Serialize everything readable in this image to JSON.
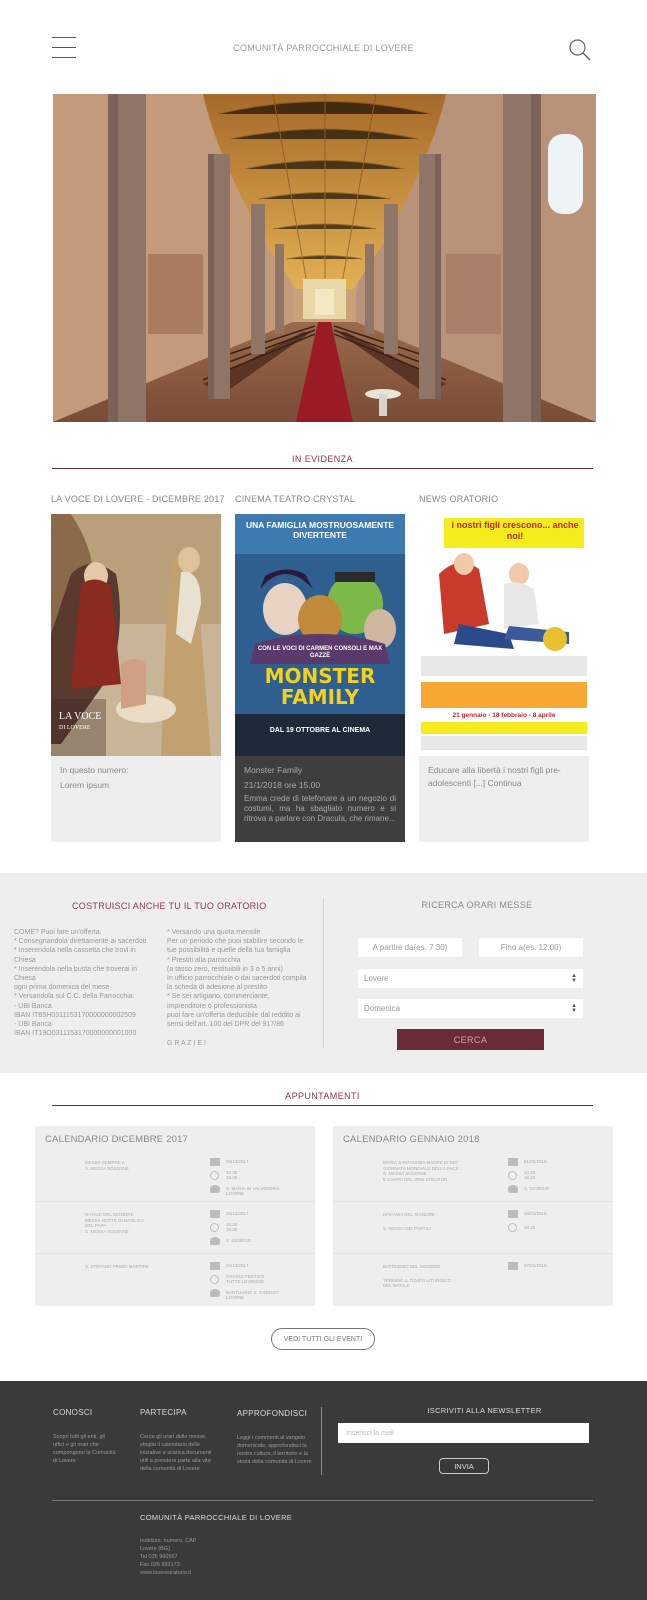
{
  "header": {
    "title": "COMUNITÀ PARROCCHIALE DI LOVERE",
    "menu_icon": "hamburger-menu-icon",
    "search_icon": "search-icon"
  },
  "evidenza": {
    "title": "IN EVIDENZA",
    "cards": [
      {
        "label": "LA VOCE DI LOVERE - DICEMBRE 2017",
        "text1": "In questo numero:",
        "text2": "Lorem ipsum"
      },
      {
        "label": "CINEMA TEATRO CRYSTAL",
        "poster_top": "UNA FAMIGLIA MOSTRUOSAMENTE DIVERTENTE",
        "poster_mid": "CON LE VOCI DI CARMEN CONSOLI E MAX GAZZÈ",
        "poster_title1": "MONSTER",
        "poster_title2": "FAMILY",
        "poster_bottom": "DAL 19 OTTOBRE AL CINEMA",
        "text1": "Monster Family",
        "text2": "21/1/2018 ore 15.00",
        "text3": "Emma crede di telefonare a un negozio di costumi, ma ha sbagliato numero e si ritrova a parlare con Dracula, che rimane..."
      },
      {
        "label": "NEWS ORATORIO",
        "flyer_title": "i nostri figli crescono... anche noi!",
        "flyer_dates": "21 gennaio - 18 febbraio - 8 aprile",
        "text1": "Educare alla libertà i nostri figli pre-adolescenti [...] Continua"
      }
    ]
  },
  "oratorio": {
    "title": "COSTRUISCI ANCHE TU IL TUO ORATORIO",
    "col1": [
      "COME? Puoi fare un'offerta:",
      "* Consegnandola direttamente ai sacerdoti",
      "* Inserendola nella cassetta che trovi in Chiesa",
      "* Inserendola nella busta che troverai in Chiesa",
      "ogni prima domenica del mese",
      "* Versandola sul C.C. della Parrocchia:",
      "- UBI Banca",
      "IBAN IT65H0311153170000000002509",
      "- UBI Banca",
      "IBAN IT19O0311153170000000001000"
    ],
    "col2": [
      "* Versando una quota mensile",
      "Per un periodo che puoi stabilire secondo le tue possibilità e quelle della tua famiglia",
      "* Prestiti alla parrocchia",
      "(a tasso zero, restituibili in 3 o 5 anni)",
      "In ufficio parrocchiale o dai sacerdoti compila la scheda di adesione al prestito",
      "* Se sei artigiano, commerciante, imprenditore o professionista",
      "puoi fare un'offerta deducibile dal reddito ai sensi dell'art. 100 del DPR del 917/86"
    ],
    "thanks": "G R A Z I E !"
  },
  "messe": {
    "title": "RICERCA ORARI MESSE",
    "from_placeholder": "A partire da(es. 7.30)",
    "to_placeholder": "Fino a(es. 12.00)",
    "place": "Lovere",
    "day": "Domenica",
    "search_label": "CERCA"
  },
  "appuntamenti": {
    "title": "APPUNTAMENTI",
    "calendars": [
      {
        "title": "CALENDARIO DICEMBRE 2017",
        "events": [
          {
            "left": [
              "MESSA SEMPRE A",
              "S. MESSA SOLENNE"
            ],
            "right": [
              "08/12/2017",
              "10.30",
              "18.30",
              "S. MARIA IN VALVENDRA",
              "LOVERE"
            ]
          },
          {
            "left": [
              "NATALE DEL SIGNORE",
              "MESSA NOTTE IN BASILICA",
              "DEL PAPA",
              "S. MESSA SOLENNE"
            ],
            "right": [
              "25/12/2017",
              "10.30",
              "18.30",
              "S. GIORGIO"
            ]
          },
          {
            "left": [
              "S. STEFANO PRIMO MARTIRE"
            ],
            "right": [
              "26/12/2017",
              "ORARIO FESTIVO",
              "TUTTE LE MESSE",
              "SANTUARIO S. GIORGIO",
              "LOVERE"
            ]
          }
        ]
      },
      {
        "title": "CALENDARIO GENNAIO 2018",
        "events": [
          {
            "left": [
              "MARIA SANTISSIMA MADRE DI DIO",
              "GIORNATA MONDIALE DELLA PACE",
              "S. MESSA SOLENNE",
              "E CANTO DEL VENI CREATOR"
            ],
            "right": [
              "01/01/2018",
              "10.30",
              "18.30",
              "S. GIORGIO"
            ]
          },
          {
            "left": [
              "EPIFANIA DEL SIGNORE",
              "S. MESSA DEI POPOLI"
            ],
            "right": [
              "06/01/2018",
              "10.30"
            ]
          },
          {
            "left": [
              "BATTESIMO DEL SIGNORE",
              "TERMINE IL TEMPO LITURGICO",
              "DEL NATALE"
            ],
            "right": [
              "07/01/2018"
            ]
          }
        ]
      }
    ],
    "all_events_label": "VEDI TUTTI GLI EVENTI"
  },
  "footer": {
    "conosci": {
      "title": "CONOSCI",
      "text": "Scopri tutti gli enti, gli uffici e gli orari che compongono la Comunità di Lovere"
    },
    "partecipa": {
      "title": "PARTECIPA",
      "text": "Cerca gli orari delle messe, sfoglia il calendario delle iniziative e scarica documenti utili a prendere parte alla vita della comunità di Lovere"
    },
    "approfondisci": {
      "title": "APPROFONDISCI",
      "text": "Leggi i commenti al vangelo domenicale, approfondisci la nostra cultura, il territorio e la storia della comunità di Lovere"
    },
    "newsletter": {
      "title": "ISCRIVITI ALLA NEWSLETTER",
      "placeholder": "Inserisci la mail",
      "button": "INVIA"
    },
    "org_name": "COMUNITÀ PARROCCHIALE DI LOVERE",
    "address": [
      "Indirizzo, numero, CAP",
      "Lovere (BG)",
      "Tel 035 960567",
      "Fax 035 983173",
      "www.lovereoratorio.it"
    ]
  }
}
